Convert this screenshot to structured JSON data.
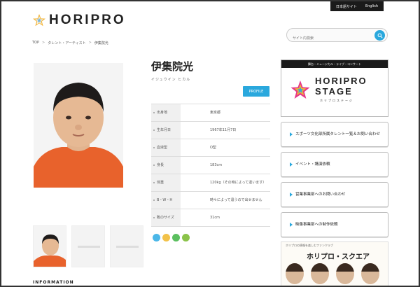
{
  "langbar": {
    "items": [
      "日本語サイト",
      "English"
    ]
  },
  "logo": {
    "word": "HORIPRO"
  },
  "search": {
    "placeholder": "サイト内検索"
  },
  "breadcrumb": {
    "items": [
      "TOP",
      "タレント・アーティスト",
      "伊集院光"
    ]
  },
  "profile": {
    "name": "伊集院光",
    "kana": "イジュウイン ヒカル",
    "profile_button": "PROFILE",
    "rows": [
      {
        "label": "出身地",
        "value": "東京都"
      },
      {
        "label": "生年月日",
        "value": "1967年11月7日"
      },
      {
        "label": "血液型",
        "value": "O型"
      },
      {
        "label": "身長",
        "value": "183cm"
      },
      {
        "label": "体重",
        "value": "120kg（その時によって違います）"
      },
      {
        "label": "B・W・H",
        "value": "時々によって違うので出せません"
      },
      {
        "label": "靴のサイズ",
        "value": "31cm"
      }
    ]
  },
  "thumbs": {
    "placeholder": "NO IMAGE"
  },
  "footer_label": "INFORMATION",
  "sidebar": {
    "stage_bar": "舞台・ミュージカル・ライブ・コンサート",
    "stage_word_1": "HORIPRO",
    "stage_word_2": "STAGE",
    "stage_sub": "ホリプロステージ",
    "buttons": [
      "スポーツ文化部所属タレント一覧＆お問い合わせ",
      "イベント・講演依頼",
      "営業事業部へのお問い合わせ",
      "映像事業部への制作依頼"
    ],
    "square_top": "ホリプロの情報を楽しむファンクラブ",
    "square_title": "ホリプロ・スクエア"
  },
  "colors": {
    "accent": "#2aa8dd",
    "shirt": "#e8622c"
  },
  "social_colors": [
    "#4bb7e8",
    "#f2c24a",
    "#5bbf5f",
    "#8bc34a"
  ]
}
